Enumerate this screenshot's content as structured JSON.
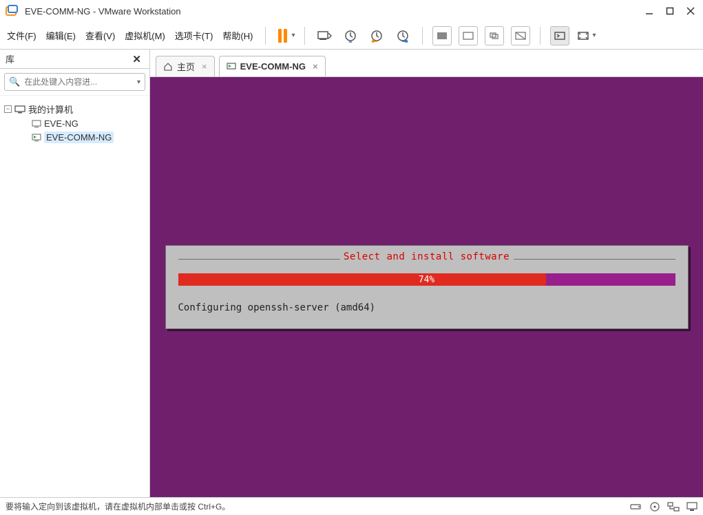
{
  "titlebar": {
    "title": "EVE-COMM-NG - VMware Workstation"
  },
  "menu": {
    "file": "文件(F)",
    "edit": "编辑(E)",
    "view": "查看(V)",
    "vm": "虚拟机(M)",
    "tabs": "选项卡(T)",
    "help": "帮助(H)"
  },
  "sidebar": {
    "title": "库",
    "search_placeholder": "在此处键入内容进...",
    "root": "我的计算机",
    "items": [
      "EVE-NG",
      "EVE-COMM-NG"
    ]
  },
  "tabs": {
    "home": "主页",
    "vm": "EVE-COMM-NG"
  },
  "installer": {
    "section_title": "Select and install software",
    "progress_pct": 74,
    "progress_label": "74%",
    "status": "Configuring openssh-server (amd64)"
  },
  "statusbar": {
    "hint": "要将输入定向到该虚拟机，请在虚拟机内部单击或按 Ctrl+G。"
  },
  "colors": {
    "vm_bg": "#701f6d",
    "progress_fill": "#e02a1f",
    "progress_track": "#991f8c",
    "section_title": "#d60000",
    "pause_orange": "#ff8a00"
  }
}
